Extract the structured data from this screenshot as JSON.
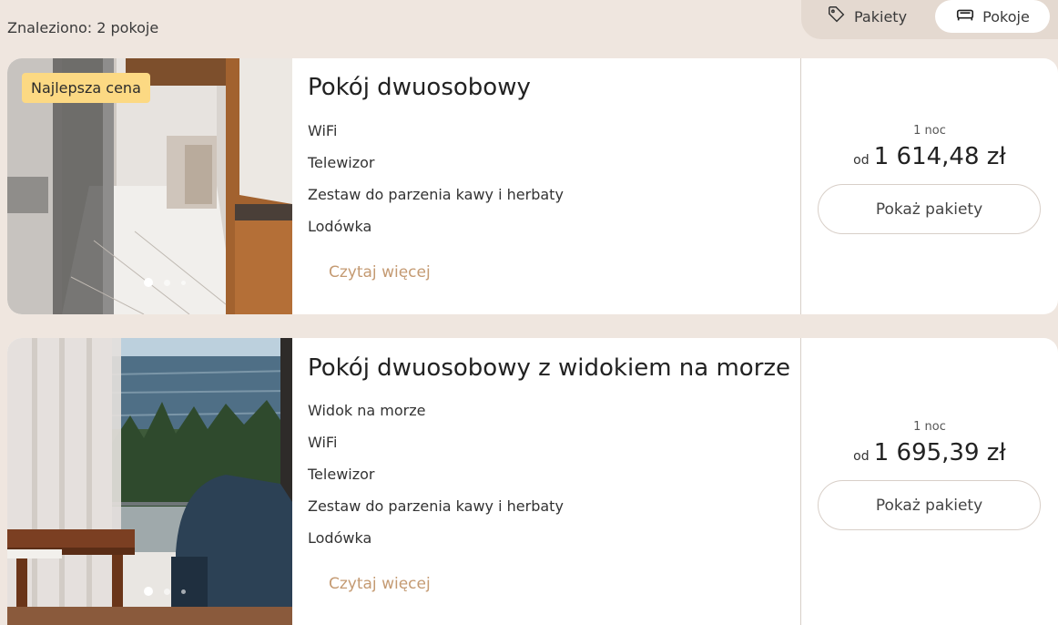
{
  "header": {
    "found_text": "Znaleziono: 2 pokoje",
    "tabs": [
      {
        "label": "Pakiety",
        "icon": "tag-icon",
        "selected": false
      },
      {
        "label": "Pokoje",
        "icon": "bed-icon",
        "selected": true
      }
    ]
  },
  "rooms": [
    {
      "badge": "Najlepsza cena",
      "title": "Pokój dwuosobowy",
      "amenities": [
        "WiFi",
        "Telewizor",
        "Zestaw do parzenia kawy i herbaty",
        "Lodówka"
      ],
      "read_more": "Czytaj więcej",
      "nights": "1 noc",
      "price_prefix": "od",
      "price": "1 614,48 zł",
      "button": "Pokaż pakiety",
      "photo_dots": 3
    },
    {
      "title": "Pokój dwuosobowy z widokiem na morze",
      "amenities": [
        "Widok na morze",
        "WiFi",
        "Telewizor",
        "Zestaw do parzenia kawy i herbaty",
        "Lodówka"
      ],
      "read_more": "Czytaj więcej",
      "nights": "1 noc",
      "price_prefix": "od",
      "price": "1 695,39 zł",
      "button": "Pokaż pakiety",
      "photo_dots": 3
    }
  ],
  "colors": {
    "background": "#efe6df",
    "accent": "#c49a72",
    "badge": "#fcd983"
  }
}
